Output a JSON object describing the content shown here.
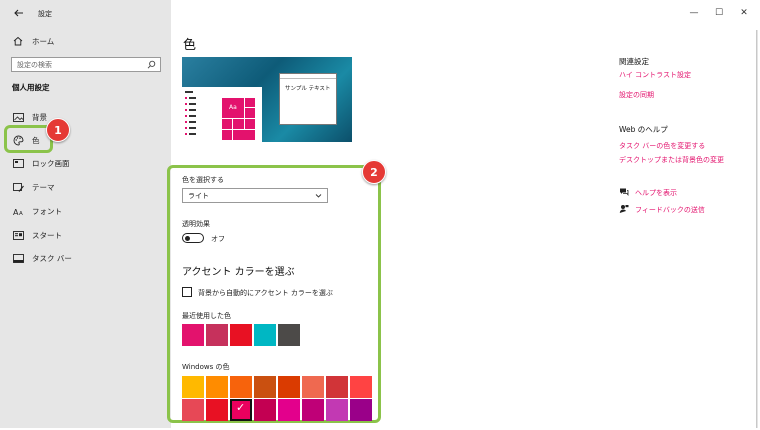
{
  "window": {
    "title": "設定",
    "minimize": "—",
    "maximize": "☐",
    "close": "✕"
  },
  "sidebar": {
    "home_label": "ホーム",
    "search_placeholder": "設定の検索",
    "section_title": "個人用設定",
    "items": [
      {
        "label": "背景",
        "icon": "image-icon"
      },
      {
        "label": "色",
        "icon": "palette-icon"
      },
      {
        "label": "ロック画面",
        "icon": "lock-screen-icon"
      },
      {
        "label": "テーマ",
        "icon": "theme-brush-icon"
      },
      {
        "label": "フォント",
        "icon": "font-icon"
      },
      {
        "label": "スタート",
        "icon": "start-icon"
      },
      {
        "label": "タスク バー",
        "icon": "taskbar-icon"
      }
    ]
  },
  "annotations": {
    "badge1": "1",
    "badge2": "2",
    "highlight_color": "#8bc34a",
    "badge_color": "#e53935"
  },
  "main": {
    "title": "色",
    "preview": {
      "window_text": "サンプル テキスト",
      "tile_text": "Aa"
    },
    "choose_color_label": "色を選択する",
    "choose_color_value": "ライト",
    "transparency_label": "透明効果",
    "transparency_state": "オフ",
    "accent_heading": "アクセント カラーを選ぶ",
    "auto_accent_label": "背景から自動的にアクセント カラーを選ぶ",
    "recent_label": "最近使用した色",
    "recent_colors": [
      "#e3126d",
      "#c6315c",
      "#e81123",
      "#00b7c3",
      "#4c4a48"
    ],
    "windows_colors_label": "Windows の色",
    "windows_colors_row1": [
      "#ffb900",
      "#ff8c00",
      "#f7630c",
      "#ca5010",
      "#da3b01",
      "#ef6950",
      "#d13438",
      "#ff4343"
    ],
    "windows_colors_row2": [
      "#e74856",
      "#e81123",
      "#ea005e",
      "#c30052",
      "#e3008c",
      "#bf0077",
      "#c239b3",
      "#9a0089"
    ],
    "selected_color_index_row2": 2,
    "selected_check": "✓"
  },
  "right_panel": {
    "related_heading": "関連設定",
    "related_links": [
      "ハイ コントラスト設定",
      "設定の同期"
    ],
    "web_help_heading": "Web のヘルプ",
    "web_links": [
      "タスク バーの色を変更する",
      "デスクトップまたは背景色の変更"
    ],
    "help_link": "ヘルプを表示",
    "feedback_link": "フィードバックの送信"
  },
  "colors": {
    "accent": "#e3126d",
    "sidebar_bg": "#e6e6e6"
  }
}
